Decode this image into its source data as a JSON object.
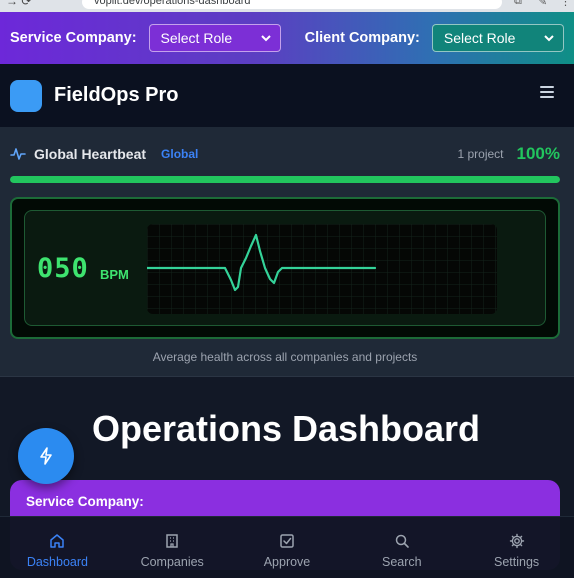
{
  "browser": {
    "url": "vopilt.dev/operations-dashboard"
  },
  "role_bar": {
    "service_label": "Service Company:",
    "service_select": "Select Role",
    "client_label": "Client Company:",
    "client_select": "Select Role"
  },
  "header": {
    "title": "FieldOps Pro"
  },
  "heartbeat": {
    "title": "Global Heartbeat",
    "scope": "Global",
    "project_count": "1 project",
    "percent": "100%",
    "progress": 1.0,
    "bpm": "050",
    "bpm_unit": "BPM",
    "caption": "Average health across all companies and projects"
  },
  "main": {
    "title": "Operations Dashboard",
    "service_card_label": "Service Company:"
  },
  "nav": [
    {
      "label": "Dashboard",
      "icon": "home-icon",
      "active": true
    },
    {
      "label": "Companies",
      "icon": "building-icon",
      "active": false
    },
    {
      "label": "Approve",
      "icon": "check-square-icon",
      "active": false
    },
    {
      "label": "Search",
      "icon": "search-icon",
      "active": false
    },
    {
      "label": "Settings",
      "icon": "gear-icon",
      "active": false
    }
  ],
  "colors": {
    "accent": "#3b82f6",
    "health": "#22c55e",
    "service_card": "#8b2fe0"
  }
}
